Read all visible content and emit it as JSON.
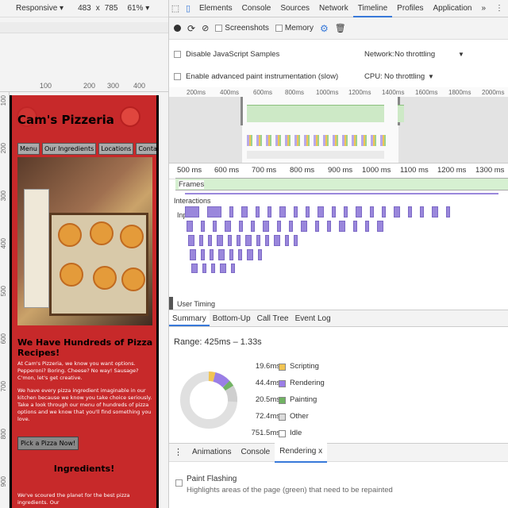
{
  "device_toolbar": {
    "mode": "Responsive ▾",
    "width": "483",
    "times": "x",
    "height": "785",
    "zoom": "61% ▾"
  },
  "ruler_h": [
    "100",
    "200",
    "300",
    "400"
  ],
  "ruler_v": [
    "100",
    "200",
    "300",
    "400",
    "500",
    "600",
    "700",
    "800",
    "900"
  ],
  "site": {
    "title": "Cam's Pizzeria",
    "nav": [
      "Menu",
      "Our Ingredients",
      "Locations",
      "Contact Us"
    ],
    "heading": "We Have Hundreds of Pizza Recipes!",
    "para1": "At Cam's Pizzeria, we know you want options. Pepperoni? Boring. Cheese? No way! Sausage? C'mon, let's get creative.",
    "para2": "We have every pizza ingredient imaginable in our kitchen because we know you take choice seriously. Take a look through our menu of hundreds of pizza options and we know that you'll find something you love.",
    "button": "Pick a Pizza Now!",
    "subheading": "Ingredients!",
    "para3": "We've scoured the planet for the best pizza ingredients. Our"
  },
  "devtools": {
    "tabs": [
      "Elements",
      "Console",
      "Sources",
      "Network",
      "Timeline",
      "Profiles",
      "Application"
    ],
    "more": "»",
    "menu": "⋮",
    "active_tab": "Timeline",
    "toolbar": {
      "screenshots": "Screenshots",
      "memory": "Memory"
    },
    "settings": {
      "disable_js": "Disable JavaScript Samples",
      "network_label": "Network:",
      "network_value": "No throttling",
      "adv_paint": "Enable advanced paint instrumentation (slow)",
      "cpu_label": "CPU:",
      "cpu_value": "No throttling"
    },
    "overview_labels": [
      "200ms",
      "400ms",
      "600ms",
      "800ms",
      "1000ms",
      "1200ms",
      "1400ms",
      "1600ms",
      "1800ms",
      "2000ms"
    ],
    "axis_labels": [
      "500 ms",
      "600 ms",
      "700 ms",
      "800 ms",
      "900 ms",
      "1000 ms",
      "1100 ms",
      "1200 ms",
      "1300 ms"
    ],
    "frames": "Frames",
    "interactions": "Interactions",
    "input": "Input",
    "user_timing": "User Timing",
    "bottom_tabs": [
      "Summary",
      "Bottom-Up",
      "Call Tree",
      "Event Log"
    ],
    "range": "Range: 425ms – 1.33s",
    "summary": [
      {
        "value": "19.6ms",
        "label": "Scripting",
        "color": "#f1c453"
      },
      {
        "value": "44.4ms",
        "label": "Rendering",
        "color": "#9a7ee6"
      },
      {
        "value": "20.5ms",
        "label": "Painting",
        "color": "#71b363"
      },
      {
        "value": "72.4ms",
        "label": "Other",
        "color": "#dadada"
      },
      {
        "value": "751.5ms",
        "label": "Idle",
        "color": "#ffffff"
      }
    ],
    "drawer_tabs": [
      "Animations",
      "Console",
      "Rendering"
    ],
    "drawer_close": "x",
    "paint_flashing": "Paint Flashing",
    "paint_flashing_desc": "Highlights areas of the page (green) that need to be repainted"
  }
}
